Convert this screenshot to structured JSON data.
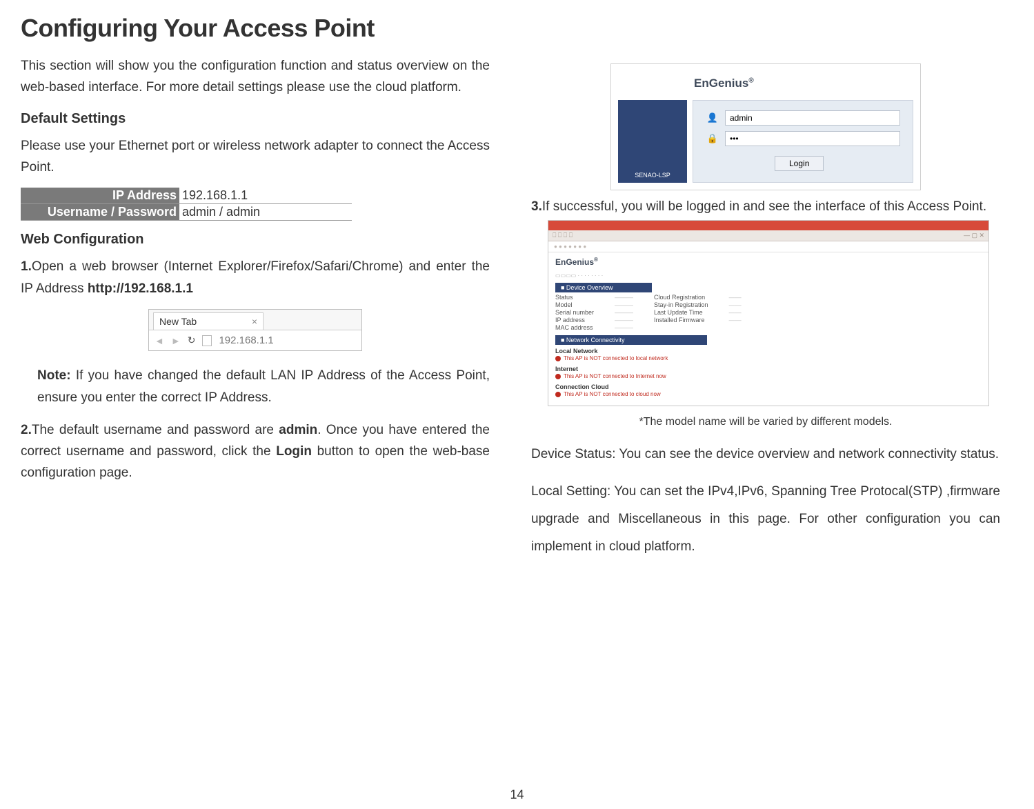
{
  "page_title": "Configuring Your Access Point",
  "intro": "This section will show you the configuration function and status overview on the web-based interface. For more detail settings please use the cloud platform.",
  "default_settings_heading": "Default Settings",
  "default_settings_text": "Please use your Ethernet port or wireless network adapter to connect the Access Point.",
  "table": {
    "ip_label": "IP Address",
    "ip_value": "192.168.1.1",
    "cred_label": "Username / Password",
    "cred_value": "admin / admin"
  },
  "web_config_heading": "Web Configuration",
  "step1_num": "1.",
  "step1_a": "Open a web browser (Internet Explorer/Firefox/Safari/Chrome) and enter the IP Address ",
  "step1_b_bold": "http://192.168.1.1",
  "browser_fig": {
    "tab_label": "New Tab",
    "url": "192.168.1.1"
  },
  "note_label": "Note:",
  "note_text": " If you have changed the default LAN IP Address of the Access Point, ensure you enter the correct IP Address.",
  "step2_num": "2.",
  "step2_a": "The default username and password are ",
  "step2_b_bold": "admin",
  "step2_c": ". Once you have entered the correct username and password, click the ",
  "step2_d_bold": "Login",
  "step2_e": " button to open the web-base configuration page.",
  "login_fig": {
    "brand": "EnGenius",
    "side_label": "SENAO-LSP",
    "username_value": "admin",
    "login_btn": "Login"
  },
  "step3_num": "3.",
  "step3_text": "If successful, you will be logged in and see the interface of this Access Point.",
  "admin_fig": {
    "brand": "EnGenius",
    "overview_head": "■ Device Overview",
    "left_labels": [
      "Status",
      "Model",
      "Serial number",
      "IP address",
      "MAC address"
    ],
    "right_labels": [
      "Cloud Registration",
      "Stay-in Registration",
      "Last Update Time",
      "Installed Firmware"
    ],
    "conn_head": "■ Network Connectivity",
    "sub1": "Local Network",
    "err1": "This AP is NOT connected to local network",
    "sub2": "Internet",
    "err2": "This AP is NOT connected to Internet now",
    "sub3": "Connection Cloud",
    "err3": "This AP is NOT connected to cloud now"
  },
  "caption": "*The model name will be varied by different models.",
  "para1": "Device Status: You can see the device overview and network connectivity status.",
  "para2": "Local Setting: You can set the IPv4,IPv6, Spanning Tree Protocal(STP) ,firmware upgrade and Miscellaneous in this page. For other configuration you can implement in cloud platform.",
  "page_number": "14"
}
